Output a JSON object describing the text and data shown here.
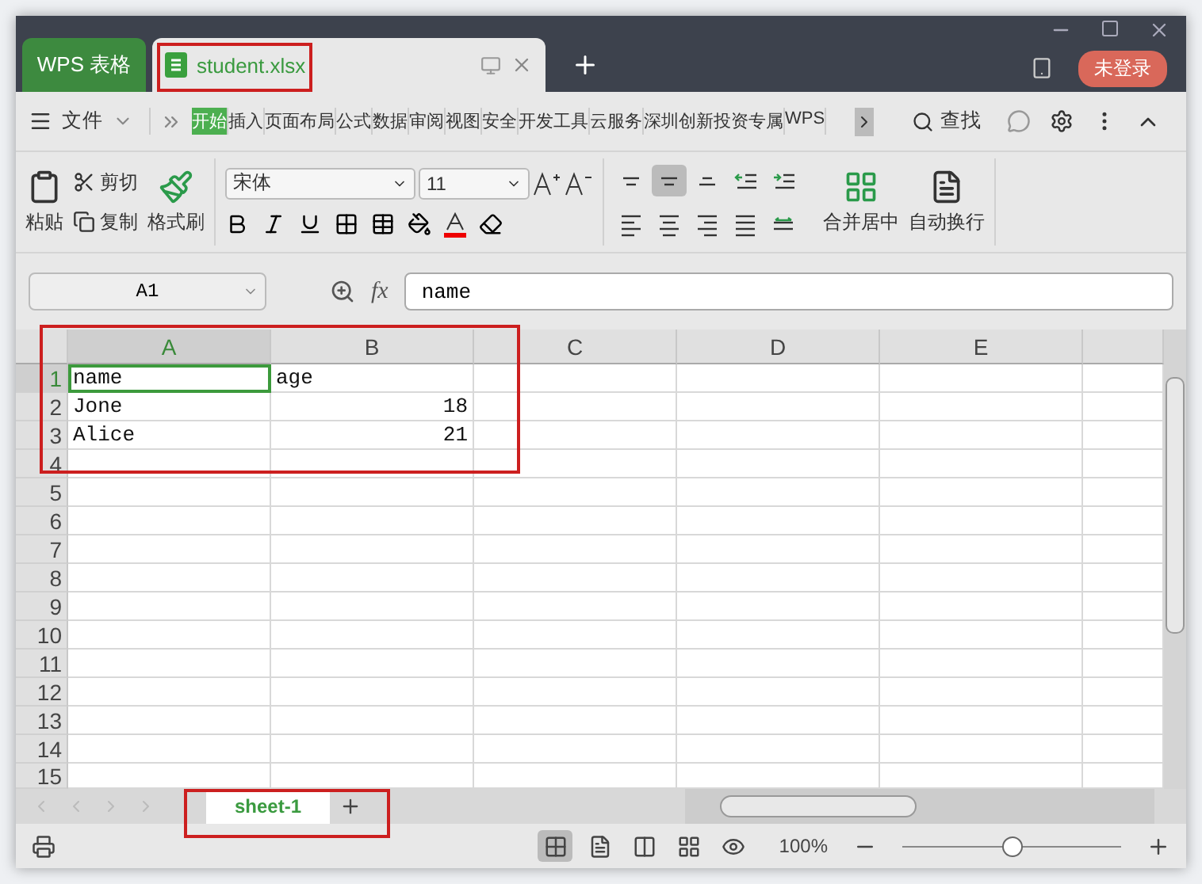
{
  "window": {
    "app_tab": "WPS 表格",
    "doc_tab": "student.xlsx",
    "login": "未登录"
  },
  "menu": {
    "file": "文件",
    "tabs": [
      {
        "label": "开始",
        "selected": true
      },
      {
        "label": "插入",
        "selected": false
      },
      {
        "label": "页面布局",
        "selected": false
      },
      {
        "label": "公式",
        "selected": false
      },
      {
        "label": "数据",
        "selected": false
      },
      {
        "label": "审阅",
        "selected": false
      },
      {
        "label": "视图",
        "selected": false
      },
      {
        "label": "安全",
        "selected": false
      },
      {
        "label": "开发工具",
        "selected": false
      },
      {
        "label": "云服务",
        "selected": false
      },
      {
        "label": "深圳创新投资专属",
        "selected": false
      },
      {
        "label": "WPS",
        "selected": false
      }
    ],
    "search": "查找"
  },
  "toolbar": {
    "paste": "粘贴",
    "cut": "剪切",
    "copy": "复制",
    "format_painter": "格式刷",
    "font": "宋体",
    "size": "11",
    "merge": "合并居中",
    "wrap": "自动换行",
    "align_buttons": [
      {
        "kind": "top",
        "selected": false
      },
      {
        "kind": "middle",
        "selected": true
      },
      {
        "kind": "bottom",
        "selected": false
      },
      {
        "kind": "outdent",
        "selected": false
      },
      {
        "kind": "indent",
        "selected": false
      },
      {
        "kind": "left",
        "selected": false
      },
      {
        "kind": "center",
        "selected": false
      },
      {
        "kind": "right",
        "selected": false
      },
      {
        "kind": "justify",
        "selected": false
      },
      {
        "kind": "distribute",
        "selected": false
      }
    ]
  },
  "formula_bar": {
    "cell_ref": "A1",
    "function_label": "fx",
    "value": "name"
  },
  "sheet": {
    "columns": [
      {
        "label": "A",
        "selected": true
      },
      {
        "label": "B",
        "selected": false
      },
      {
        "label": "C",
        "selected": false
      },
      {
        "label": "D",
        "selected": false
      },
      {
        "label": "E",
        "selected": false
      }
    ],
    "rows": [
      {
        "header": "1",
        "selected": true,
        "cells": [
          {
            "text": "name",
            "kind": "text",
            "selected": true
          },
          {
            "text": "age",
            "kind": "text",
            "selected": false
          }
        ]
      },
      {
        "header": "2",
        "selected": false,
        "cells": [
          {
            "text": "Jone",
            "kind": "text",
            "selected": false
          },
          {
            "text": "18",
            "kind": "number",
            "selected": false
          }
        ]
      },
      {
        "header": "3",
        "selected": false,
        "cells": [
          {
            "text": "Alice",
            "kind": "text",
            "selected": false
          },
          {
            "text": "21",
            "kind": "number",
            "selected": false
          }
        ]
      },
      {
        "header": "4",
        "selected": false,
        "cells": []
      },
      {
        "header": "5",
        "selected": false,
        "cells": []
      },
      {
        "header": "6",
        "selected": false,
        "cells": []
      },
      {
        "header": "7",
        "selected": false,
        "cells": []
      },
      {
        "header": "8",
        "selected": false,
        "cells": []
      },
      {
        "header": "9",
        "selected": false,
        "cells": []
      },
      {
        "header": "10",
        "selected": false,
        "cells": []
      },
      {
        "header": "11",
        "selected": false,
        "cells": []
      },
      {
        "header": "12",
        "selected": false,
        "cells": []
      },
      {
        "header": "13",
        "selected": false,
        "cells": []
      },
      {
        "header": "14",
        "selected": false,
        "cells": []
      },
      {
        "header": "15",
        "selected": false,
        "cells": []
      }
    ]
  },
  "sheet_tabs": [
    {
      "label": "sheet-1",
      "selected": true
    }
  ],
  "status_bar": {
    "views": [
      {
        "kind": "normal",
        "selected": true
      },
      {
        "kind": "page",
        "selected": false
      },
      {
        "kind": "break",
        "selected": false
      },
      {
        "kind": "layout",
        "selected": false
      },
      {
        "kind": "eye",
        "selected": false
      }
    ],
    "zoom": "100%",
    "zoom_slider": {
      "level": 0.5
    }
  }
}
